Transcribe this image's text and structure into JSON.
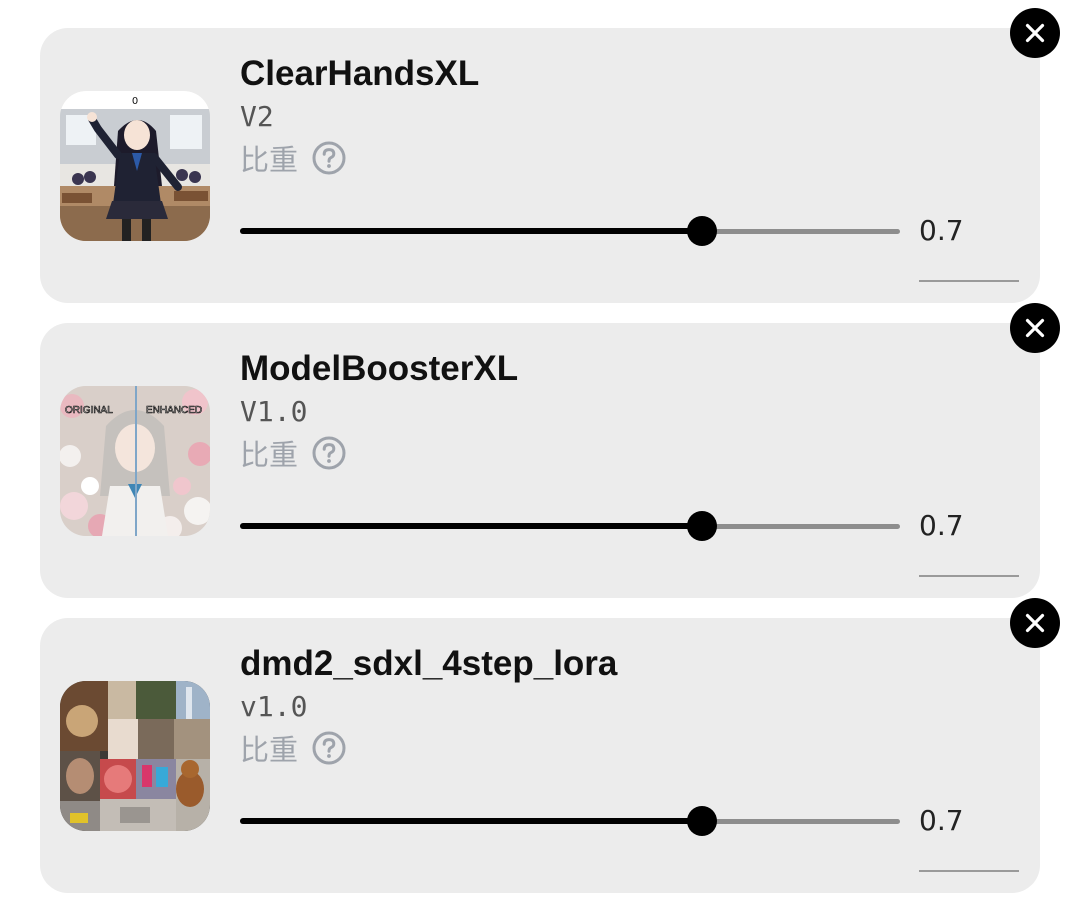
{
  "loras": [
    {
      "name": "ClearHandsXL",
      "version": "V2",
      "weight_label": "比重",
      "weight": 0.7,
      "weight_text": "0.7",
      "thumbnail_caption": "0"
    },
    {
      "name": "ModelBoosterXL",
      "version": "V1.0",
      "weight_label": "比重",
      "weight": 0.7,
      "weight_text": "0.7",
      "thumbnail_left_label": "ORIGINAL",
      "thumbnail_right_label": "ENHANCED"
    },
    {
      "name": "dmd2_sdxl_4step_lora",
      "version": "v1.0",
      "weight_label": "比重",
      "weight": 0.7,
      "weight_text": "0.7"
    }
  ],
  "slider": {
    "min": 0,
    "max": 1
  },
  "colors": {
    "card_bg": "#ececec",
    "accent": "#000000",
    "muted_label": "#9ea3ab",
    "track": "#8d8d8d"
  },
  "icons": {
    "remove": "close-icon",
    "help": "question-circle-icon"
  }
}
